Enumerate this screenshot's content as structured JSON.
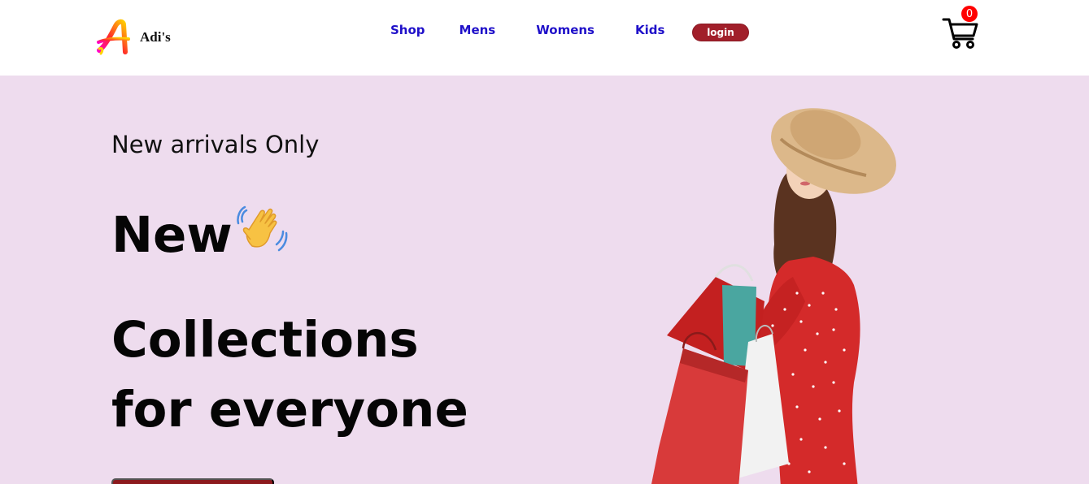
{
  "header": {
    "brand": "Adi's",
    "logo_letter": "A",
    "nav": {
      "shop": "Shop",
      "mens": "Mens",
      "womens": "Womens",
      "kids": "Kids"
    },
    "login_label": "login",
    "cart_count": "0",
    "cart_icon": "shopping-cart-icon"
  },
  "hero": {
    "subtitle": "New arrivals Only",
    "line1": "New",
    "line2": "Collections",
    "line3": "for everyone",
    "wave_icon": "waving-hand-icon",
    "cta_label": ""
  },
  "colors": {
    "nav_link": "#1f10c9",
    "login_bg": "#a11f2a",
    "hero_bg": "#eedcee",
    "cart_badge": "#ff0000",
    "cta_bg": "#8c1a1e"
  }
}
